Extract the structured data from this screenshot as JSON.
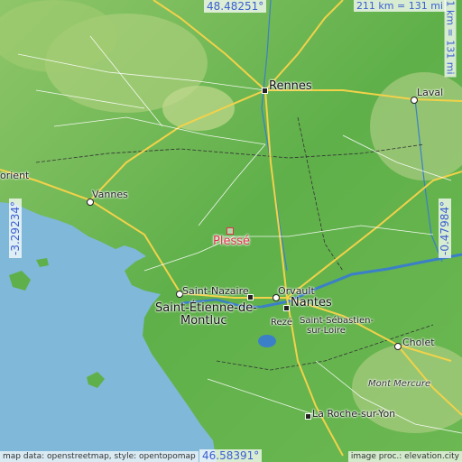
{
  "coords": {
    "top": "48.48251°",
    "bottom": "46.58391°",
    "left": "-3.29234°",
    "right": "-0.47984°"
  },
  "scale": {
    "horizontal": "211 km = 131 mi",
    "vertical": "211 km = 131 mi"
  },
  "highlight": {
    "name": "Plessé",
    "color": "#e0334a"
  },
  "cities": {
    "rennes": "Rennes",
    "laval": "Laval",
    "lorient": "orient",
    "vannes": "Vannes",
    "saint_nazaire": "Saint-Nazaire",
    "saint_etienne": "Saint-Étienne-de-",
    "montluc": "Montluc",
    "orvault": "Orvault",
    "nantes": "Nantes",
    "reze": "Rezé",
    "saint_sebastien_1": "Saint-Sébastien-",
    "saint_sebastien_2": "sur-Loire",
    "cholet": "Cholet",
    "mont_mercure": "Mont Mercure",
    "la_roche": "La Roche-sur-Yon"
  },
  "attribution": {
    "left": "map data: openstreetmap, style: opentopomap",
    "right": "image proc.: elevation.city"
  },
  "colors": {
    "sea": "#7fb8d8",
    "land": "#5fb04a",
    "land_light": "#8fc66a",
    "highland": "#b5d08a",
    "road_major": "#f2d24a",
    "road_minor": "#ffffff",
    "river": "#3b7fc8",
    "border": "#333333"
  }
}
